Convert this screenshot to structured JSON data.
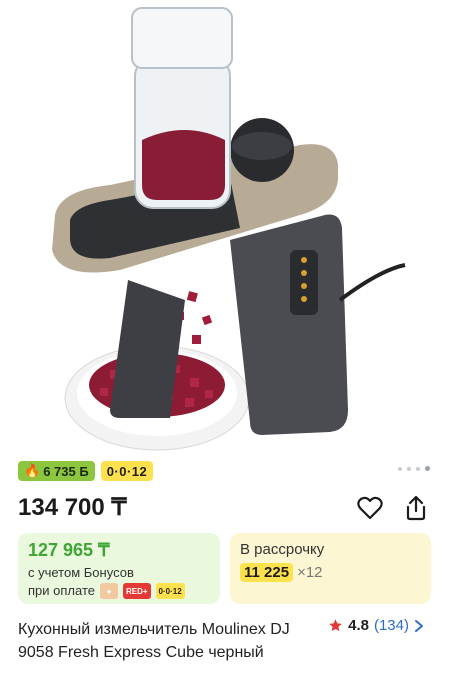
{
  "product": {
    "image_alt": "Кухонный измельчитель Moulinex DJ 9058",
    "carousel": {
      "count": 4,
      "active": 4
    },
    "bonus_badge": "6 735 Б",
    "installment_badge": "0·0·12",
    "price": "134 700 ₸",
    "bonus_card": {
      "price": "127 965 ₸",
      "line1": "с учетом Бонусов",
      "line2": "при оплате",
      "icons": [
        "kaspi-icon",
        "red-icon",
        "installment-icon"
      ],
      "icon_red_label": "RED+",
      "icon_installment_label": "0·0·12"
    },
    "installment_card": {
      "label": "В рассрочку",
      "amount": "11 225",
      "months": "×12"
    },
    "title": "Кухонный измельчитель Moulinex DJ 9058 Fresh Express Cube черный",
    "rating": {
      "value": "4.8",
      "count": "(134)"
    }
  },
  "colors": {
    "accent_green": "#3fa535",
    "badge_yellow": "#ffe14d",
    "star": "#e53935",
    "link": "#2b6ec6"
  }
}
